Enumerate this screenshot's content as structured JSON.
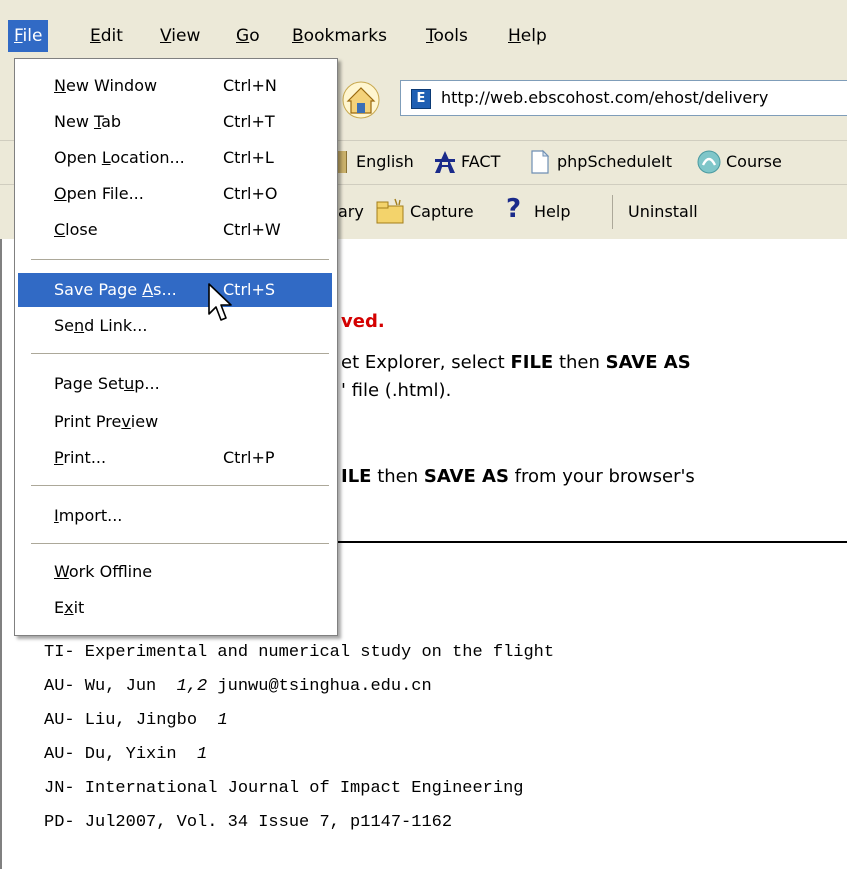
{
  "menubar": {
    "items": [
      {
        "label": "File",
        "accel": "F",
        "rest": "ile"
      },
      {
        "label": "Edit",
        "accel": "E",
        "rest": "dit"
      },
      {
        "label": "View",
        "accel": "V",
        "rest": "iew"
      },
      {
        "label": "Go",
        "accel": "G",
        "rest": "o"
      },
      {
        "label": "Bookmarks",
        "accel": "B",
        "rest": "ookmarks"
      },
      {
        "label": "Tools",
        "accel": "T",
        "rest": "ools"
      },
      {
        "label": "Help",
        "accel": "H",
        "rest": "elp"
      }
    ]
  },
  "navbar": {
    "url": "http://web.ebscohost.com/ehost/delivery"
  },
  "bookmarks": {
    "items": [
      "English",
      "FACT",
      "phpScheduleIt",
      "Course"
    ]
  },
  "extension_bar": {
    "library_partial": "ary",
    "capture": "Capture",
    "help": "Help",
    "uninstall": "Uninstall"
  },
  "file_menu": {
    "items": [
      {
        "pre": "",
        "accel": "N",
        "post": "ew Window",
        "shortcut": "Ctrl+N"
      },
      {
        "pre": "New ",
        "accel": "T",
        "post": "ab",
        "shortcut": "Ctrl+T"
      },
      {
        "pre": "Open ",
        "accel": "L",
        "post": "ocation...",
        "shortcut": "Ctrl+L"
      },
      {
        "pre": "",
        "accel": "O",
        "post": "pen File...",
        "shortcut": "Ctrl+O"
      },
      {
        "pre": "",
        "accel": "C",
        "post": "lose",
        "shortcut": "Ctrl+W"
      },
      {
        "pre": "Save Page ",
        "accel": "A",
        "post": "s...",
        "shortcut": "Ctrl+S"
      },
      {
        "pre": "Se",
        "accel": "n",
        "post": "d Link...",
        "shortcut": ""
      },
      {
        "pre": "Page Set",
        "accel": "u",
        "post": "p...",
        "shortcut": ""
      },
      {
        "pre": "Print Pre",
        "accel": "v",
        "post": "iew",
        "shortcut": ""
      },
      {
        "pre": "",
        "accel": "P",
        "post": "rint...",
        "shortcut": "Ctrl+P"
      },
      {
        "pre": "",
        "accel": "I",
        "post": "mport...",
        "shortcut": ""
      },
      {
        "pre": "",
        "accel": "W",
        "post": "ork Offline",
        "shortcut": ""
      },
      {
        "pre": "E",
        "accel": "x",
        "post": "it",
        "shortcut": ""
      }
    ]
  },
  "content": {
    "saved_partial": "ved.",
    "line1_pre": "et Explorer, select ",
    "line1_b1": "FILE",
    "line1_mid": " then ",
    "line1_b2": "SAVE AS",
    "line2": "' file (.html).",
    "line3_b1": "ILE",
    "line3_mid": " then ",
    "line3_b2": "SAVE AS",
    "line3_post": " from your browser's",
    "citation": [
      {
        "text": "TI- Experimental and numerical study on the flight",
        "ital": "",
        "tail": ""
      },
      {
        "text": "AU- Wu, Jun  ",
        "ital": "1,2",
        "tail": " junwu@tsinghua.edu.cn"
      },
      {
        "text": "AU- Liu, Jingbo  ",
        "ital": "1",
        "tail": ""
      },
      {
        "text": "AU- Du, Yixin  ",
        "ital": "1",
        "tail": ""
      },
      {
        "text": "JN- International Journal of Impact Engineering",
        "ital": "",
        "tail": ""
      },
      {
        "text": "PD- Jul2007, Vol. 34 Issue 7, p1147-1162",
        "ital": "",
        "tail": ""
      }
    ]
  }
}
